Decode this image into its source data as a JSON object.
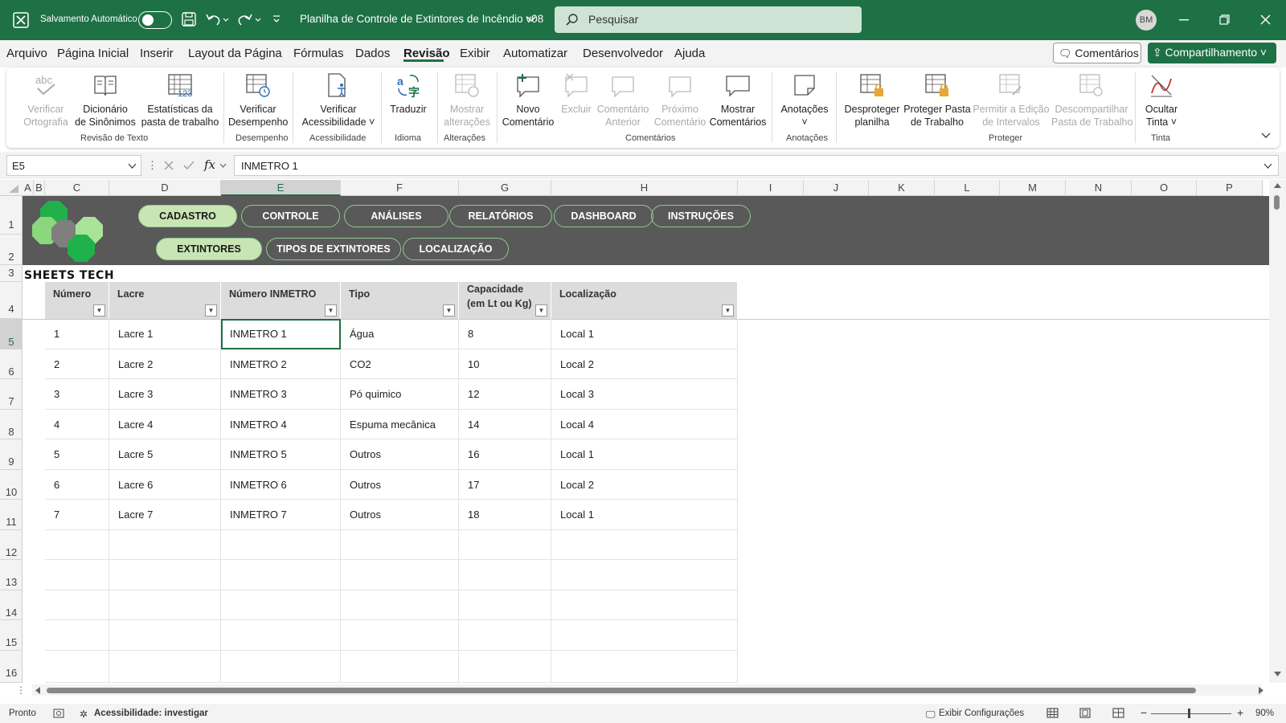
{
  "titlebar": {
    "autosave_label": "Salvamento Automático",
    "file_title": "Planilha de Controle de Extintores de Incêndio v08",
    "search_placeholder": "Pesquisar",
    "avatar_initials": "BM"
  },
  "menu": {
    "items": [
      "Arquivo",
      "Página Inicial",
      "Inserir",
      "Layout da Página",
      "Fórmulas",
      "Dados",
      "Revisão",
      "Exibir",
      "Automatizar",
      "Desenvolvedor",
      "Ajuda"
    ],
    "active": "Revisão",
    "comments_button": "Comentários",
    "share_button": "Compartilhamento"
  },
  "ribbon": {
    "buttons": {
      "spelling": [
        "Verificar",
        "Ortografia"
      ],
      "thesaurus": [
        "Dicionário",
        "de Sinônimos"
      ],
      "stats": [
        "Estatísticas da",
        "pasta de trabalho"
      ],
      "performance": [
        "Verificar",
        "Desempenho"
      ],
      "accessibility": [
        "Verificar",
        "Acessibilidade ˅"
      ],
      "translate": [
        "Traduzir",
        ""
      ],
      "show_changes": [
        "Mostrar",
        "alterações"
      ],
      "new_comment": [
        "Novo",
        "Comentário"
      ],
      "delete": [
        "Excluir",
        ""
      ],
      "prev_comment": [
        "Comentário",
        "Anterior"
      ],
      "next_comment": [
        "Próximo",
        "Comentário"
      ],
      "show_comments": [
        "Mostrar",
        "Comentários"
      ],
      "notes": [
        "Anotações",
        "˅"
      ],
      "unprotect_sheet": [
        "Desproteger",
        "planilha"
      ],
      "protect_workbook": [
        "Proteger Pasta",
        "de Trabalho"
      ],
      "allow_edit": [
        "Permitir a Edição",
        "de Intervalos"
      ],
      "unshare": [
        "Descompartilhar",
        "Pasta de Trabalho"
      ],
      "hide_ink": [
        "Ocultar",
        "Tinta ˅"
      ]
    },
    "groups": {
      "proofing": "Revisão de Texto",
      "performance": "Desempenho",
      "accessibility": "Acessibilidade",
      "language": "Idioma",
      "changes": "Alterações",
      "comments": "Comentários",
      "notes": "Anotações",
      "protect": "Proteger",
      "ink": "Tinta"
    }
  },
  "formula_bar": {
    "name_box": "E5",
    "fx": "fx",
    "value": "INMETRO 1"
  },
  "columns": [
    "A",
    "B",
    "C",
    "D",
    "E",
    "F",
    "G",
    "H",
    "I",
    "J",
    "K",
    "L",
    "M",
    "N",
    "O",
    "P"
  ],
  "selected_column": "E",
  "rows": [
    "1",
    "2",
    "3",
    "4",
    "5",
    "6",
    "7",
    "8",
    "9",
    "10",
    "11",
    "12",
    "13",
    "14",
    "15",
    "16"
  ],
  "selected_row": "5",
  "nav": {
    "main": [
      "CADASTRO",
      "CONTROLE",
      "ANÁLISES",
      "RELATÓRIOS",
      "DASHBOARD",
      "INSTRUÇÕES"
    ],
    "sub": [
      "EXTINTORES",
      "TIPOS DE EXTINTORES",
      "LOCALIZAÇÃO"
    ],
    "active_main": "CADASTRO",
    "active_sub": "EXTINTORES"
  },
  "brand": "SHEETS TECH",
  "table": {
    "headers": [
      "Número",
      "Lacre",
      "Número INMETRO",
      "Tipo",
      "Capacidade (em Lt ou Kg)",
      "Localização"
    ],
    "header_cap_line1": "Capacidade",
    "header_cap_line2": "(em Lt ou Kg)",
    "rows": [
      [
        "1",
        "Lacre 1",
        "INMETRO 1",
        "Água",
        "8",
        "Local 1"
      ],
      [
        "2",
        "Lacre 2",
        "INMETRO 2",
        "CO2",
        "10",
        "Local 2"
      ],
      [
        "3",
        "Lacre 3",
        "INMETRO 3",
        "Pó quimico",
        "12",
        "Local 3"
      ],
      [
        "4",
        "Lacre 4",
        "INMETRO 4",
        "Espuma mecânica",
        "14",
        "Local 4"
      ],
      [
        "5",
        "Lacre 5",
        "INMETRO 5",
        "Outros",
        "16",
        "Local 1"
      ],
      [
        "6",
        "Lacre 6",
        "INMETRO 6",
        "Outros",
        "17",
        "Local 2"
      ],
      [
        "7",
        "Lacre 7",
        "INMETRO 7",
        "Outros",
        "18",
        "Local 1"
      ]
    ]
  },
  "status": {
    "ready": "Pronto",
    "accessibility": "Acessibilidade: investigar",
    "display_settings": "Exibir Configurações",
    "zoom": "90%"
  },
  "colors": {
    "excel_green": "#1e7145",
    "banner": "#595959",
    "pill_active": "#c8e6b4"
  }
}
